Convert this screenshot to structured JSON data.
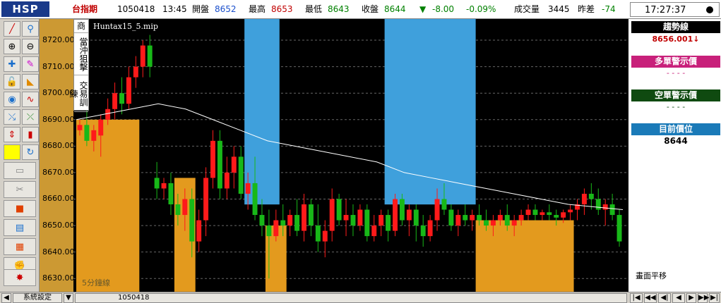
{
  "logo": "HSP",
  "quote": {
    "name": "台指期",
    "date": "1050418",
    "time": "13:45",
    "open_label": "開盤",
    "open": "8652",
    "high_label": "最高",
    "high": "8653",
    "low_label": "最低",
    "low": "8643",
    "close_label": "收盤",
    "close": "8644",
    "change": "-8.00",
    "change_pct": "-0.09%",
    "volume_label": "成交量",
    "volume": "3445",
    "diff_label": "昨差",
    "diff": "-74"
  },
  "clock": "17:27:37",
  "price_axis": [
    "8720.00",
    "8710.00",
    "8700.00",
    "8690.00",
    "8680.00",
    "8670.00",
    "8660.00",
    "8650.00",
    "8640.00",
    "8630.00"
  ],
  "side_tabs": [
    "商",
    "當沖狙擊",
    "交易訓練"
  ],
  "chart": {
    "title": "Huntax15_5.mip",
    "footer": "5分鐘線"
  },
  "right_panel": {
    "trend_label": "趨勢線",
    "trend_value": "8656.001↓",
    "long_label": "多單警示價",
    "long_value": "- - - -",
    "short_label": "空單警示價",
    "short_value": "- - - -",
    "pos_label": "目前價位",
    "pos_value": "8644",
    "pan_label": "畫面平移"
  },
  "status": {
    "settings": "系統設定",
    "date": "1050418"
  },
  "chart_data": {
    "type": "candlestick",
    "ylim": [
      8625,
      8728
    ],
    "candles": [
      [
        8686,
        8690,
        8684,
        8688
      ],
      [
        8688,
        8694,
        8680,
        8682
      ],
      [
        8682,
        8688,
        8678,
        8686
      ],
      [
        8684,
        8692,
        8676,
        8690
      ],
      [
        8690,
        8698,
        8688,
        8694
      ],
      [
        8694,
        8704,
        8690,
        8700
      ],
      [
        8700,
        8706,
        8692,
        8696
      ],
      [
        8696,
        8710,
        8694,
        8706
      ],
      [
        8706,
        8714,
        8702,
        8710
      ],
      [
        8710,
        8720,
        8706,
        8718
      ],
      [
        8718,
        8722,
        8706,
        8710
      ],
      [
        8668,
        8674,
        8660,
        8664
      ],
      [
        8664,
        8668,
        8660,
        8666
      ],
      [
        8666,
        8670,
        8654,
        8658
      ],
      [
        8658,
        8662,
        8650,
        8654
      ],
      [
        8654,
        8664,
        8648,
        8660
      ],
      [
        8660,
        8664,
        8638,
        8644
      ],
      [
        8644,
        8656,
        8640,
        8652
      ],
      [
        8652,
        8672,
        8646,
        8668
      ],
      [
        8668,
        8686,
        8664,
        8682
      ],
      [
        8682,
        8686,
        8660,
        8664
      ],
      [
        8664,
        8676,
        8660,
        8670
      ],
      [
        8670,
        8680,
        8664,
        8676
      ],
      [
        8676,
        8680,
        8660,
        8662
      ],
      [
        8662,
        8670,
        8656,
        8666
      ],
      [
        8666,
        8676,
        8652,
        8654
      ],
      [
        8654,
        8660,
        8646,
        8650
      ],
      [
        8650,
        8656,
        8630,
        8646
      ],
      [
        8646,
        8656,
        8644,
        8652
      ],
      [
        8652,
        8658,
        8646,
        8650
      ],
      [
        8650,
        8656,
        8646,
        8654
      ],
      [
        8654,
        8660,
        8646,
        8648
      ],
      [
        8648,
        8662,
        8644,
        8658
      ],
      [
        8658,
        8660,
        8646,
        8650
      ],
      [
        8650,
        8658,
        8640,
        8644
      ],
      [
        8644,
        8652,
        8638,
        8648
      ],
      [
        8648,
        8664,
        8644,
        8660
      ],
      [
        8660,
        8662,
        8650,
        8652
      ],
      [
        8652,
        8660,
        8646,
        8654
      ],
      [
        8654,
        8658,
        8646,
        8650
      ],
      [
        8650,
        8658,
        8648,
        8656
      ],
      [
        8656,
        8658,
        8644,
        8646
      ],
      [
        8646,
        8654,
        8644,
        8650
      ],
      [
        8650,
        8656,
        8646,
        8654
      ],
      [
        8654,
        8656,
        8644,
        8648
      ],
      [
        8648,
        8662,
        8646,
        8660
      ],
      [
        8660,
        8662,
        8650,
        8652
      ],
      [
        8652,
        8658,
        8646,
        8656
      ],
      [
        8656,
        8658,
        8644,
        8650
      ],
      [
        8650,
        8654,
        8642,
        8646
      ],
      [
        8646,
        8654,
        8644,
        8652
      ],
      [
        8652,
        8664,
        8648,
        8660
      ],
      [
        8660,
        8666,
        8654,
        8656
      ],
      [
        8656,
        8658,
        8648,
        8650
      ],
      [
        8650,
        8656,
        8646,
        8654
      ],
      [
        8654,
        8658,
        8650,
        8652
      ],
      [
        8652,
        8656,
        8648,
        8654
      ],
      [
        8654,
        8658,
        8650,
        8652
      ],
      [
        8652,
        8656,
        8648,
        8650
      ],
      [
        8650,
        8654,
        8646,
        8652
      ],
      [
        8652,
        8656,
        8650,
        8654
      ],
      [
        8654,
        8658,
        8648,
        8650
      ],
      [
        8650,
        8654,
        8646,
        8652
      ],
      [
        8652,
        8656,
        8650,
        8654
      ],
      [
        8654,
        8658,
        8652,
        8656
      ],
      [
        8656,
        8658,
        8652,
        8654
      ],
      [
        8654,
        8656,
        8652,
        8655
      ],
      [
        8655,
        8658,
        8652,
        8654
      ],
      [
        8654,
        8656,
        8650,
        8653
      ],
      [
        8653,
        8656,
        8651,
        8655
      ],
      [
        8655,
        8658,
        8652,
        8656
      ],
      [
        8656,
        8660,
        8652,
        8658
      ],
      [
        8658,
        8664,
        8654,
        8662
      ],
      [
        8662,
        8666,
        8656,
        8660
      ],
      [
        8660,
        8664,
        8654,
        8656
      ],
      [
        8656,
        8660,
        8650,
        8658
      ],
      [
        8658,
        8662,
        8652,
        8654
      ],
      [
        8654,
        8656,
        8642,
        8644
      ]
    ],
    "trend_line": [
      8690,
      8692,
      8694,
      8696,
      8694,
      8690,
      8686,
      8682,
      8680,
      8678,
      8676,
      8674,
      8670,
      8668,
      8666,
      8664,
      8662,
      8660,
      8658,
      8657,
      8656
    ],
    "shaded_bands": [
      [
        24,
        28
      ],
      [
        44,
        56
      ]
    ],
    "orange_bands": [
      [
        0,
        8,
        8690
      ],
      [
        14,
        16,
        8668
      ],
      [
        27,
        29,
        8650
      ],
      [
        57,
        70,
        8652
      ]
    ]
  }
}
